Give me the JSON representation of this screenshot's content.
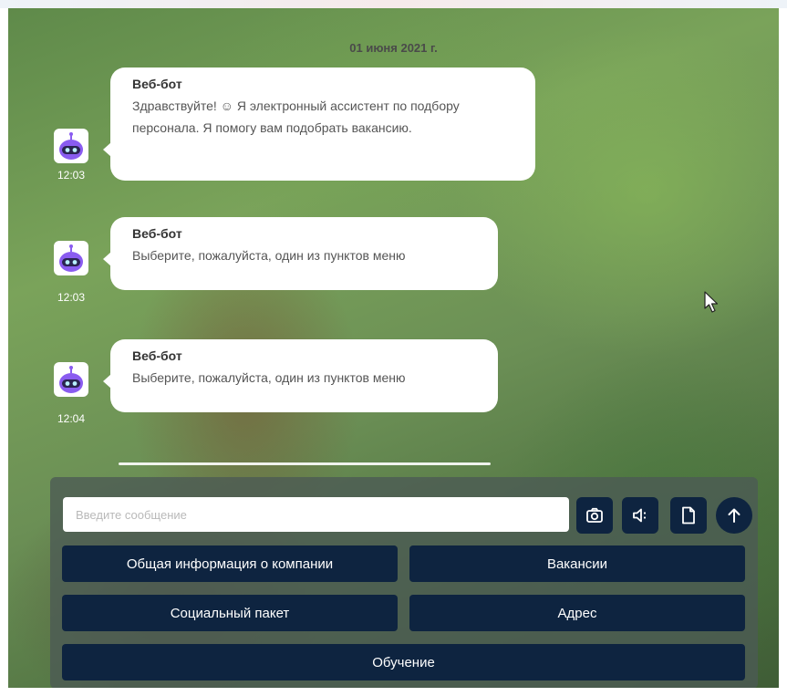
{
  "chat": {
    "date": "01 июня 2021 г.",
    "messages": [
      {
        "sender": "Веб-бот",
        "text": "Здравствуйте! ☺ Я электронный ассистент по подбору персонала. Я помогу вам подобрать вакансию.",
        "time": "12:03"
      },
      {
        "sender": "Веб-бот",
        "text": "Выберите, пожалуйста, один из пунктов меню",
        "time": "12:03"
      },
      {
        "sender": "Веб-бот",
        "text": "Выберите, пожалуйста, один из пунктов меню",
        "time": "12:04"
      }
    ]
  },
  "composer": {
    "placeholder": "Введите сообщение",
    "icons": [
      "camera-icon",
      "speaker-icon",
      "file-icon",
      "arrow-up-icon"
    ]
  },
  "menu": {
    "buttons": [
      "Общая информация о компании",
      "Вакансии",
      "Социальный пакет",
      "Адрес",
      "Обучение"
    ]
  },
  "colors": {
    "button_bg": "#0e2440",
    "bubble_bg": "#ffffff",
    "avatar_bot": "#8a5cf0"
  }
}
